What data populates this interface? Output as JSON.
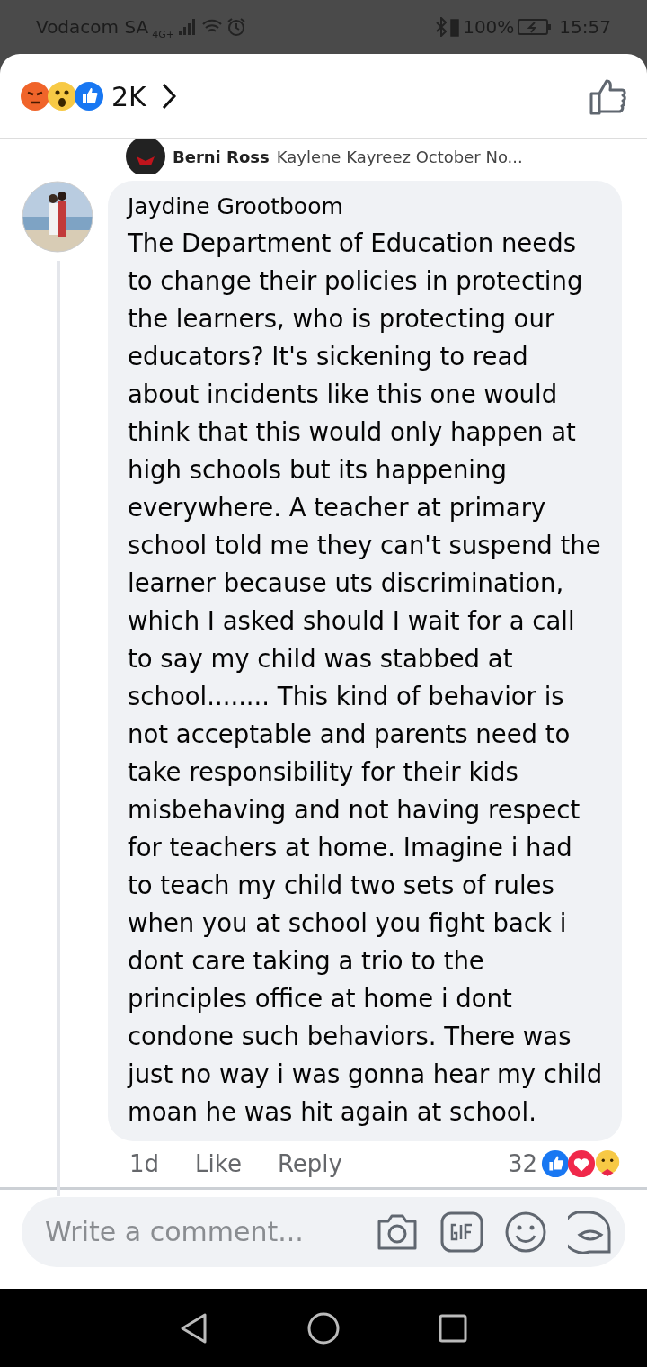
{
  "status_bar": {
    "carrier": "Vodacom SA",
    "network": "4G+",
    "battery_text": "100%",
    "time": "15:57"
  },
  "header": {
    "reaction_count": "2K"
  },
  "previous_reply": {
    "author": "Berni Ross",
    "text": "Kaylene Kayreez October No..."
  },
  "comment": {
    "author": "Jaydine Grootboom",
    "text": "The Department of Education needs to change their policies in protecting the learners, who is protecting our educators? It's sickening to read about incidents like this one would think that this would only happen at high schools but its happening everywhere. A teacher at primary school told me they can't suspend the learner because uts discrimination, which I asked should I wait for a call to say my child was stabbed at school........ This kind of behavior is not acceptable and parents need to take responsibility for their kids misbehaving and not having respect for teachers at home. Imagine i had to teach my child two sets of rules when you at school you fight back i dont care taking a trio to the principles office at home i dont condone such behaviors. There was just no way i was gonna hear my child moan he was hit again at school.",
    "time": "1d",
    "actions": [
      "Like",
      "Reply"
    ],
    "reaction_count": "32"
  },
  "composer": {
    "placeholder": "Write a comment..."
  }
}
